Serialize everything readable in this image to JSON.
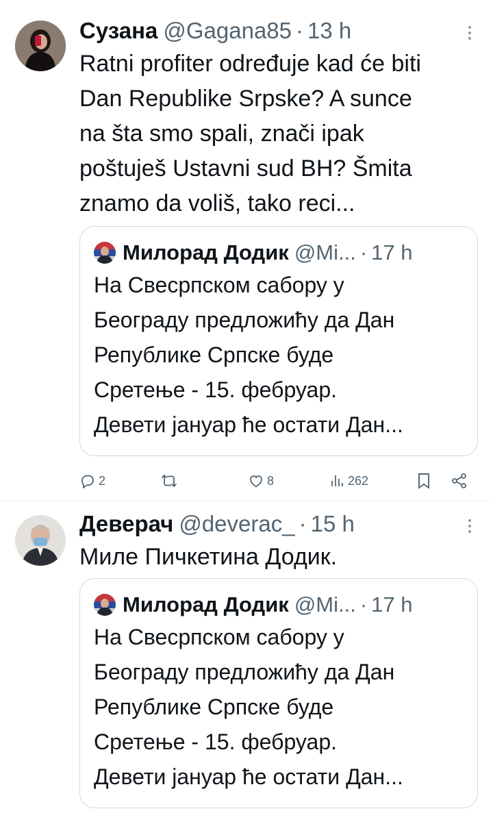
{
  "tweets": [
    {
      "author_name": "Сузана",
      "author_handle": "@Gagana85",
      "time": "13 h",
      "text_lines": [
        "Ratni profiter određuje kad će biti",
        "Dan Republike Srpske? A sunce",
        "na šta smo spali, znači ipak",
        "poštuješ Ustavni sud BH? Šmita",
        "znamo da voliš, tako reci..."
      ],
      "quote": {
        "author_name": "Милорад Додик",
        "author_handle": "@Mi...",
        "time": "17 h",
        "text_lines": [
          "На Свесрпском сабору у",
          "Београду предложићу да Дан",
          "Републике Српске буде",
          "Сретење - 15. фебруар.",
          "Девети јануар ће остати Дан..."
        ]
      },
      "actions": {
        "replies": "2",
        "reposts": "",
        "likes": "8",
        "views": "262"
      }
    },
    {
      "author_name": "Деверач",
      "author_handle": "@deverac_",
      "time": "15 h",
      "text_lines": [
        "Миле Пичкетина Додик."
      ],
      "quote": {
        "author_name": "Милорад Додик",
        "author_handle": "@Mi...",
        "time": "17 h",
        "text_lines": [
          "На Свесрпском сабору у",
          "Београду предложићу да Дан",
          "Републике Српске буде",
          "Сретење - 15. фебруар.",
          "Девети јануар ће остати Дан..."
        ]
      }
    }
  ],
  "separator": "·",
  "colors": {
    "text": "#0f1419",
    "secondary": "#536471",
    "border": "#cfd9de"
  },
  "icons": [
    "reply-icon",
    "repost-icon",
    "like-icon",
    "views-icon",
    "bookmark-icon",
    "share-icon",
    "more-icon"
  ]
}
